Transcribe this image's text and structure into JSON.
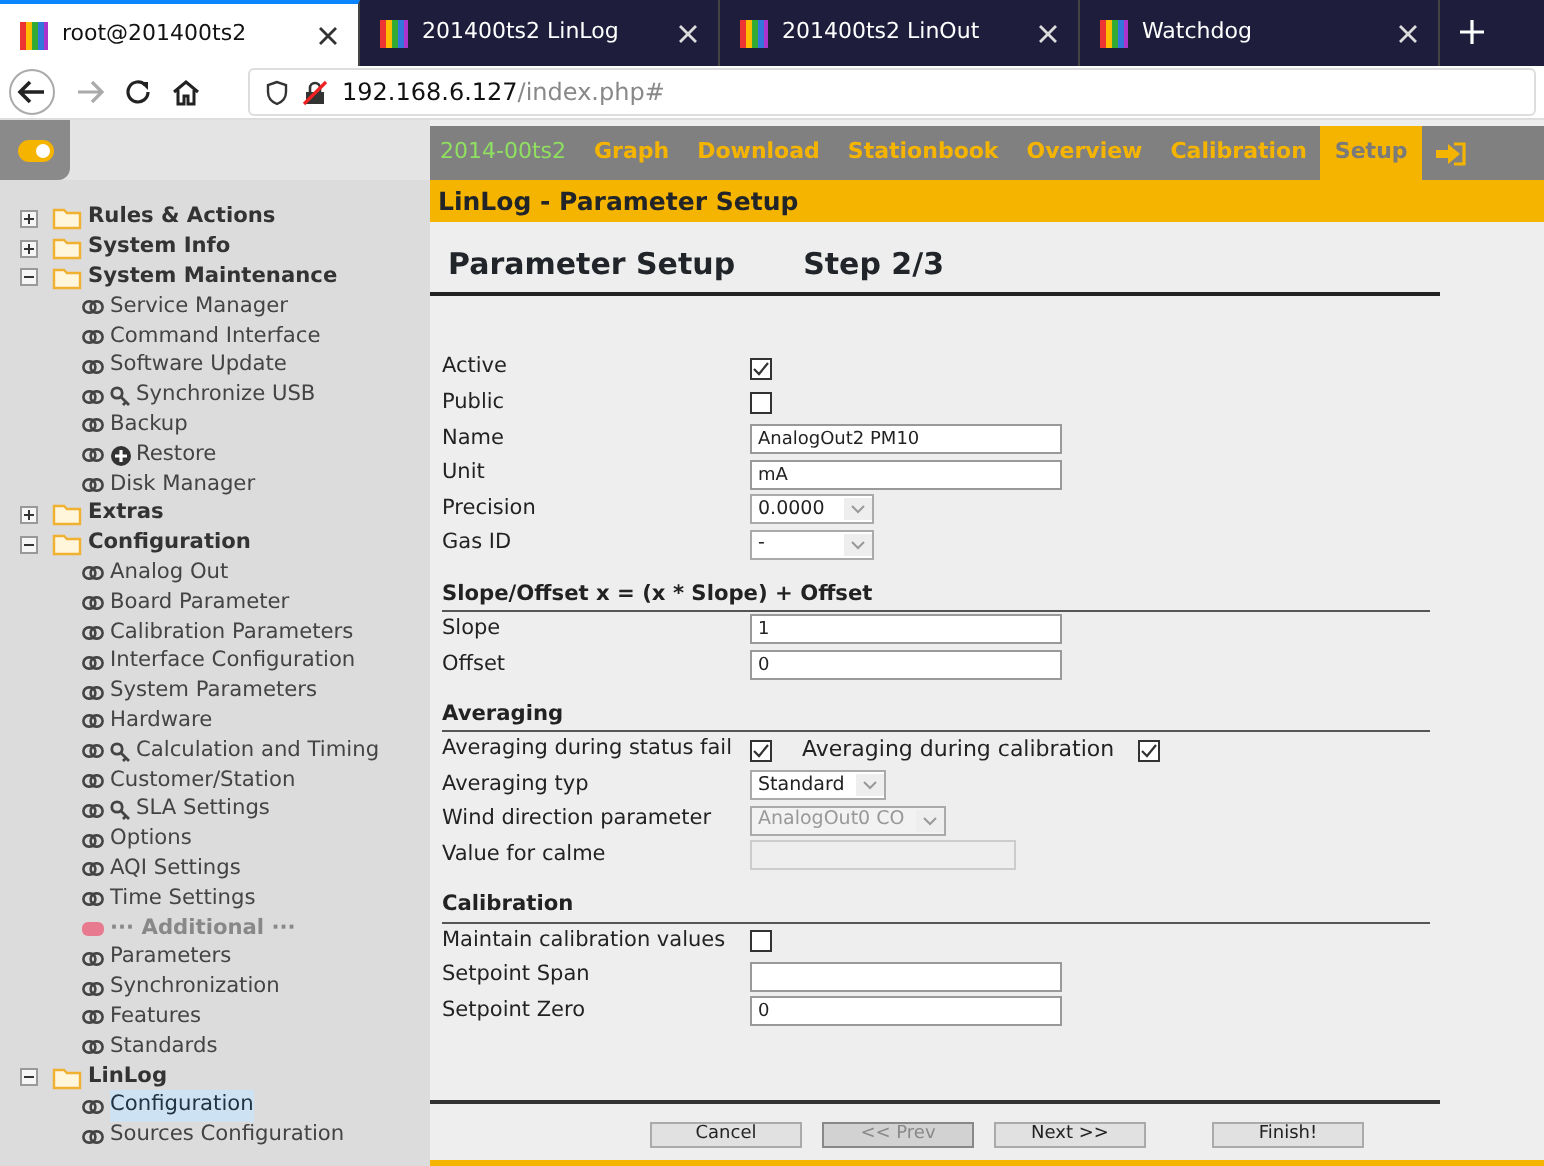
{
  "browser_tabs": [
    {
      "title": "root@201400ts2",
      "selected": true
    },
    {
      "title": "201400ts2 LinLog",
      "selected": false
    },
    {
      "title": "201400ts2 LinOut",
      "selected": false
    },
    {
      "title": "Watchdog",
      "selected": false
    }
  ],
  "address": {
    "host": "192.168.6.127",
    "path": "/index.php#"
  },
  "nav": [
    {
      "label": "2014-00ts2",
      "kind": "station",
      "selected": false
    },
    {
      "label": "Graph",
      "kind": "link",
      "selected": false
    },
    {
      "label": "Download",
      "kind": "link",
      "selected": false
    },
    {
      "label": "Stationbook",
      "kind": "link",
      "selected": false
    },
    {
      "label": "Overview",
      "kind": "link",
      "selected": false
    },
    {
      "label": "Calibration",
      "kind": "link",
      "selected": false
    },
    {
      "label": "Setup",
      "kind": "link",
      "selected": true
    }
  ],
  "sidebar": {
    "items": [
      {
        "label": "Rules & Actions",
        "kind": "folder",
        "expanded": false
      },
      {
        "label": "System Info",
        "kind": "folder",
        "expanded": false
      },
      {
        "label": "System Maintenance",
        "kind": "folder",
        "expanded": true,
        "children": [
          {
            "label": "Service Manager",
            "kind": "link",
            "selected": false
          },
          {
            "label": "Command Interface",
            "kind": "link",
            "selected": false
          },
          {
            "label": "Software Update",
            "kind": "link",
            "selected": false
          },
          {
            "label": "Synchronize USB",
            "kind": "key-link",
            "selected": false
          },
          {
            "label": "Backup",
            "kind": "link",
            "selected": false
          },
          {
            "label": "Restore",
            "kind": "add-link",
            "selected": false
          },
          {
            "label": "Disk Manager",
            "kind": "link",
            "selected": false
          }
        ]
      },
      {
        "label": "Extras",
        "kind": "folder",
        "expanded": false
      },
      {
        "label": "Configuration",
        "kind": "folder",
        "expanded": true,
        "children": [
          {
            "label": "Analog Out",
            "kind": "link",
            "selected": false
          },
          {
            "label": "Board Parameter",
            "kind": "link",
            "selected": false
          },
          {
            "label": "Calibration Parameters",
            "kind": "link",
            "selected": false
          },
          {
            "label": "Interface Configuration",
            "kind": "link",
            "selected": false
          },
          {
            "label": "System Parameters",
            "kind": "link",
            "selected": false
          },
          {
            "label": "Hardware",
            "kind": "link",
            "selected": false
          },
          {
            "label": "Calculation and Timing",
            "kind": "key-link",
            "selected": false
          },
          {
            "label": "Customer/Station",
            "kind": "link",
            "selected": false
          },
          {
            "label": "SLA Settings",
            "kind": "key-link",
            "selected": false
          },
          {
            "label": "Options",
            "kind": "link",
            "selected": false
          },
          {
            "label": "AQI Settings",
            "kind": "link",
            "selected": false
          },
          {
            "label": "Time Settings",
            "kind": "link",
            "selected": false
          },
          {
            "label": "··· Additional ···",
            "kind": "section"
          },
          {
            "label": "Parameters",
            "kind": "link",
            "selected": false
          },
          {
            "label": "Synchronization",
            "kind": "link",
            "selected": false
          },
          {
            "label": "Features",
            "kind": "link",
            "selected": false
          },
          {
            "label": "Standards",
            "kind": "link",
            "selected": false
          }
        ]
      },
      {
        "label": "LinLog",
        "kind": "folder",
        "expanded": true,
        "children": [
          {
            "label": "Configuration",
            "kind": "link",
            "selected": true
          },
          {
            "label": "Sources Configuration",
            "kind": "link",
            "selected": false
          }
        ]
      }
    ]
  },
  "header": "LinLog - Parameter Setup",
  "title": "Parameter Setup",
  "step": "Step 2/3",
  "form": [
    {
      "kind": "checkbox",
      "label": "Active",
      "checked": true
    },
    {
      "kind": "checkbox",
      "label": "Public",
      "checked": false
    },
    {
      "kind": "text",
      "label": "Name",
      "value": "AnalogOut2 PM10",
      "disabled": false
    },
    {
      "kind": "text",
      "label": "Unit",
      "value": "mA",
      "disabled": false
    },
    {
      "kind": "select",
      "label": "Precision",
      "value": "0.0000",
      "disabled": false
    },
    {
      "kind": "select",
      "label": "Gas ID",
      "value": "-",
      "disabled": false
    },
    {
      "kind": "section",
      "label": "Slope/Offset x = (x * Slope) + Offset"
    },
    {
      "kind": "text",
      "label": "Slope",
      "value": "1",
      "disabled": false
    },
    {
      "kind": "text",
      "label": "Offset",
      "value": "0",
      "disabled": false
    },
    {
      "kind": "section",
      "label": "Averaging"
    },
    {
      "kind": "check-pair",
      "label": "Averaging during status fail",
      "checked": true,
      "label2": "Averaging during calibration",
      "checked2": true
    },
    {
      "kind": "select",
      "label": "Averaging typ",
      "value": "Standard",
      "disabled": false
    },
    {
      "kind": "select",
      "label": "Wind direction parameter",
      "value": "AnalogOut0 CO",
      "disabled": true
    },
    {
      "kind": "text",
      "label": "Value for calme",
      "disabled": true
    },
    {
      "kind": "section",
      "label": "Calibration"
    },
    {
      "kind": "checkbox",
      "label": "Maintain calibration values",
      "checked": false
    },
    {
      "kind": "text",
      "label": "Setpoint Span",
      "disabled": false
    },
    {
      "kind": "text",
      "label": "Setpoint Zero",
      "value": "0",
      "disabled": false
    }
  ],
  "buttons": [
    {
      "label": "Cancel",
      "disabled": false
    },
    {
      "label": "<< Prev",
      "disabled": true
    },
    {
      "label": "Next >>",
      "disabled": false
    },
    {
      "label": "Finish!",
      "disabled": false
    }
  ]
}
